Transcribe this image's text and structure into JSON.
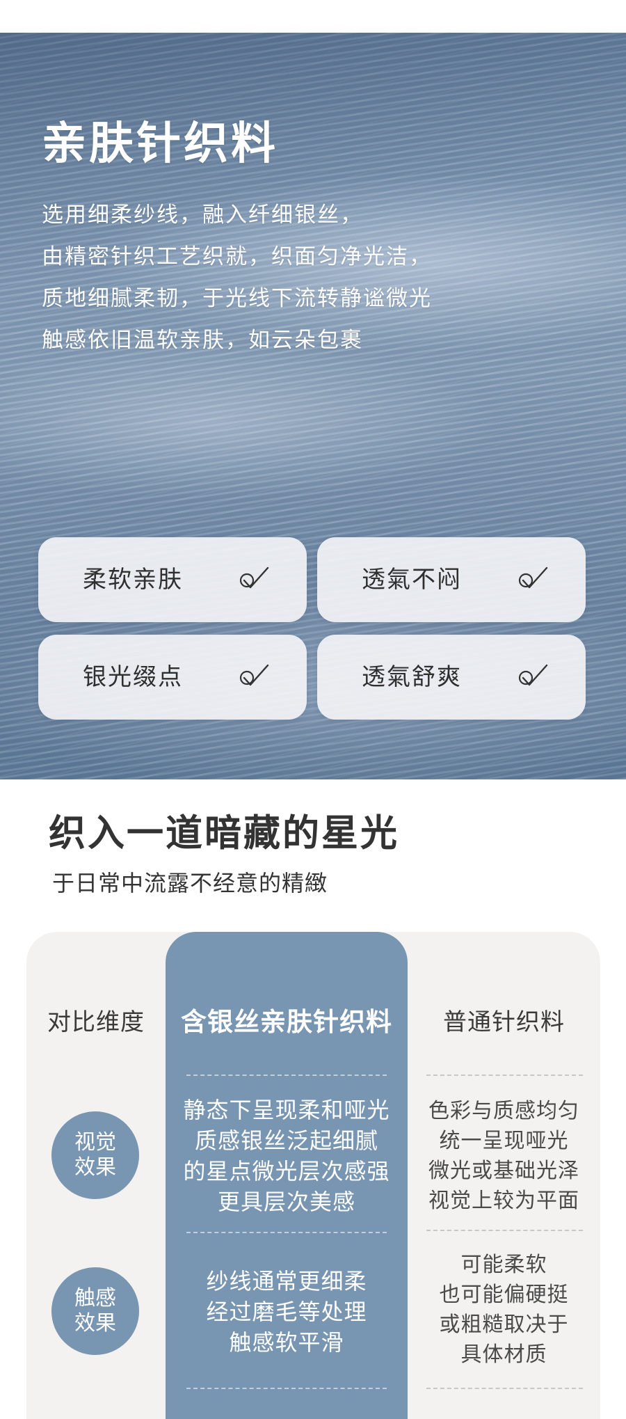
{
  "hero": {
    "title": "亲肤针织料",
    "lines": [
      "选用细柔纱线，融入纤细银丝，",
      "由精密针织工艺织就，织面匀净光洁，",
      "质地细腻柔韧，于光线下流转静谧微光",
      "触感依旧温软亲肤，如云朵包裹"
    ],
    "features": [
      "柔软亲肤",
      "透氣不闷",
      "银光缀点",
      "透氣舒爽"
    ],
    "check_icon": "check-icon"
  },
  "section": {
    "title": "织入一道暗藏的星光",
    "subtitle": "于日常中流露不经意的精緻"
  },
  "table": {
    "headers": [
      "对比维度",
      "含银丝亲肤针织料",
      "普通针织料"
    ],
    "rows": [
      {
        "dimension": [
          "视觉",
          "效果"
        ],
        "silver": [
          "静态下呈现柔和哑光",
          "质感银丝泛起细腻",
          "的星点微光层次感强",
          "更具层次美感"
        ],
        "normal": [
          "色彩与质感均匀",
          "统一呈现哑光",
          "微光或基础光泽",
          "视觉上较为平面"
        ]
      },
      {
        "dimension": [
          "触感",
          "效果"
        ],
        "silver": [
          "纱线通常更细柔",
          "经过磨毛等处理",
          "触感软平滑"
        ],
        "normal": [
          "可能柔软",
          "也可能偏硬挺",
          "或粗糙取决于",
          "具体材质"
        ]
      }
    ]
  },
  "colors": {
    "accent": "#7895b1",
    "table_bg": "#f3f2f1",
    "text_dark": "#333333"
  }
}
